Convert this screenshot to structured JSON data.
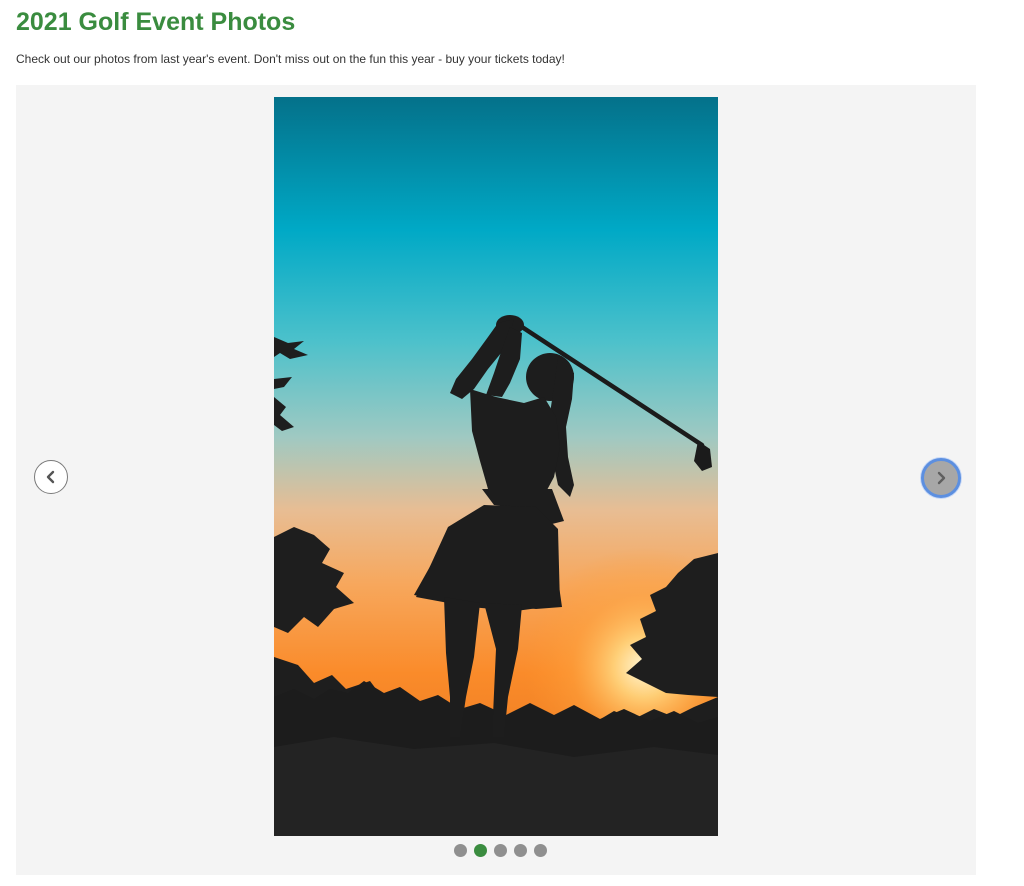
{
  "header": {
    "title": "2021 Golf Event Photos",
    "intro": "Check out our photos from last year's event. Don't miss out on the fun this year - buy your tickets today!"
  },
  "carousel": {
    "prev_icon": "chevron-left-icon",
    "next_icon": "chevron-right-icon",
    "slide_count": 5,
    "active_slide": 2,
    "slide_alt": "Silhouette of a golfer swinging a club at sunset"
  },
  "colors": {
    "title_green": "#3a8c3f",
    "active_dot": "#3a8c3f",
    "inactive_dot": "#8f8f8f",
    "carousel_bg": "#f4f4f4",
    "focus_ring": "#5c8fe0"
  }
}
